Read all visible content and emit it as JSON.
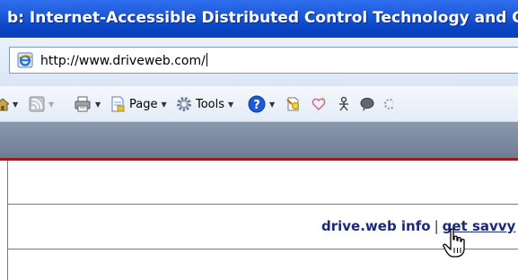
{
  "window": {
    "title": "b: Internet-Accessible Distributed Control Technology and Onl"
  },
  "address_bar": {
    "url": "http://www.driveweb.com/"
  },
  "command_bar": {
    "page_label": "Page",
    "tools_label": "Tools"
  },
  "page": {
    "nav": {
      "link1": "drive.web info",
      "separator": "|",
      "link2": "get savvy"
    }
  },
  "colors": {
    "title_bar": "#1d5ad8",
    "nav_link": "#1a2a7a",
    "red_rule": "#9a1c1c",
    "blue_strip": "#7a8aa0"
  }
}
